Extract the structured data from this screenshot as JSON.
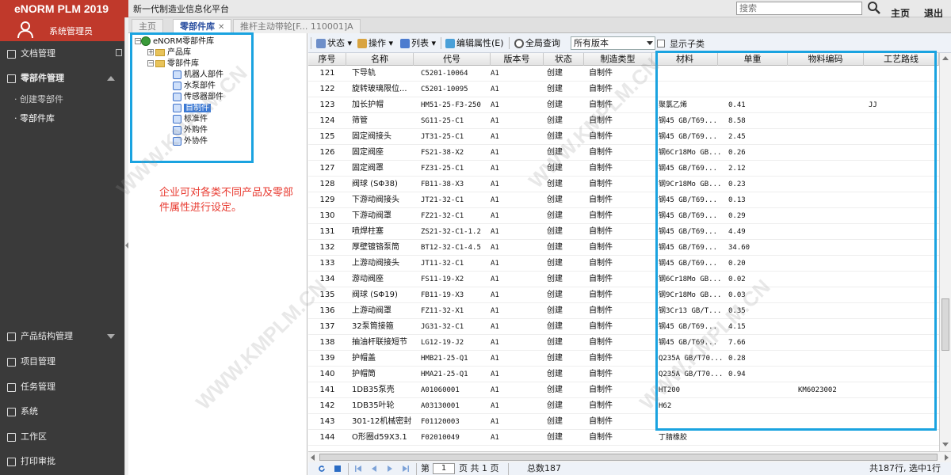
{
  "app": {
    "brand": "eNORM PLM 2019",
    "subtitle": "新一代制造业信息化平台",
    "search_placeholder": "搜索",
    "home_link": "主页",
    "logout_link": "退出"
  },
  "sidebar": {
    "user": "系统管理员",
    "items_top": [
      {
        "label": "文档管理"
      },
      {
        "label": "零部件管理"
      }
    ],
    "sub_items": [
      {
        "label": "· 创建零部件"
      },
      {
        "label": "· 零部件库"
      }
    ],
    "items_bottom": [
      {
        "label": "产品结构管理"
      },
      {
        "label": "项目管理"
      },
      {
        "label": "任务管理"
      },
      {
        "label": "系统"
      },
      {
        "label": "工作区"
      },
      {
        "label": "打印审批"
      }
    ]
  },
  "tabs": [
    {
      "label": "主页"
    },
    {
      "label": "零部件库"
    },
    {
      "label": "推杆主动带轮[F... 110001]A"
    }
  ],
  "tree": {
    "root": "eNORM零部件库",
    "nodes": [
      {
        "label": "产品库"
      },
      {
        "label": "零部件库"
      },
      {
        "label": "机器人部件"
      },
      {
        "label": "水泵部件"
      },
      {
        "label": "传感器部件"
      },
      {
        "label": "自制件"
      },
      {
        "label": "标准件"
      },
      {
        "label": "外购件"
      },
      {
        "label": "外协件"
      }
    ]
  },
  "note": "企业可对各类不同产品及零部件属性进行设定。",
  "toolbar": {
    "status": "状态",
    "operate": "操作",
    "list": "列表",
    "edit_attr": "编辑属性(E)",
    "global_query": "全局查询",
    "version_select": "所有版本",
    "show_children": "显示子类"
  },
  "grid": {
    "headers": [
      "序号",
      "名称",
      "代号",
      "版本号",
      "状态",
      "制造类型",
      "材料",
      "单重",
      "物料编码",
      "工艺路线"
    ],
    "rows": [
      [
        "121",
        "下导轨",
        "C5201-10064",
        "A1",
        "创建",
        "自制件",
        "",
        "",
        "",
        ""
      ],
      [
        "122",
        "旋转玻璃限位...",
        "C5201-10095",
        "A1",
        "创建",
        "自制件",
        "",
        "",
        "",
        ""
      ],
      [
        "123",
        "加长护帽",
        "HM51-25-F3-250",
        "A1",
        "创建",
        "自制件",
        "聚氯乙烯",
        "0.41",
        "",
        "JJ"
      ],
      [
        "124",
        "筛管",
        "SG11-25-C1",
        "A1",
        "创建",
        "自制件",
        "钢45 GB/T69...",
        "8.58",
        "",
        ""
      ],
      [
        "125",
        "固定阀接头",
        "JT31-25-C1",
        "A1",
        "创建",
        "自制件",
        "钢45 GB/T69...",
        "2.45",
        "",
        ""
      ],
      [
        "126",
        "固定阀座",
        "FS21-38-X2",
        "A1",
        "创建",
        "自制件",
        "钢6Cr18Mo GB...",
        "0.26",
        "",
        ""
      ],
      [
        "127",
        "固定阀罩",
        "FZ31-25-C1",
        "A1",
        "创建",
        "自制件",
        "钢45 GB/T69...",
        "2.12",
        "",
        ""
      ],
      [
        "128",
        "阀球 (SΦ38)",
        "FB11-38-X3",
        "A1",
        "创建",
        "自制件",
        "钢9Cr18Mo GB...",
        "0.23",
        "",
        ""
      ],
      [
        "129",
        "下游动阀接头",
        "JT21-32-C1",
        "A1",
        "创建",
        "自制件",
        "钢45 GB/T69...",
        "0.13",
        "",
        ""
      ],
      [
        "130",
        "下游动阀罩",
        "FZ21-32-C1",
        "A1",
        "创建",
        "自制件",
        "钢45 GB/T69...",
        "0.29",
        "",
        ""
      ],
      [
        "131",
        "喷焊柱塞",
        "ZS21-32-C1-1.2",
        "A1",
        "创建",
        "自制件",
        "钢45 GB/T69...",
        "4.49",
        "",
        ""
      ],
      [
        "132",
        "厚壁镀铬泵筒",
        "BT12-32-C1-4.5",
        "A1",
        "创建",
        "自制件",
        "钢45 GB/T69...",
        "34.60",
        "",
        ""
      ],
      [
        "133",
        "上游动阀接头",
        "JT11-32-C1",
        "A1",
        "创建",
        "自制件",
        "钢45 GB/T69...",
        "0.20",
        "",
        ""
      ],
      [
        "134",
        "游动阀座",
        "FS11-19-X2",
        "A1",
        "创建",
        "自制件",
        "钢6Cr18Mo GB...",
        "0.02",
        "",
        ""
      ],
      [
        "135",
        "阀球 (SΦ19)",
        "FB11-19-X3",
        "A1",
        "创建",
        "自制件",
        "钢9Cr18Mo GB...",
        "0.03",
        "",
        ""
      ],
      [
        "136",
        "上游动阀罩",
        "FZ11-32-X1",
        "A1",
        "创建",
        "自制件",
        "钢3Cr13 GB/T...",
        "0.35",
        "",
        ""
      ],
      [
        "137",
        "32泵筒接箍",
        "JG31-32-C1",
        "A1",
        "创建",
        "自制件",
        "钢45 GB/T69...",
        "4.15",
        "",
        ""
      ],
      [
        "138",
        "抽油杆联接短节",
        "LG12-19-J2",
        "A1",
        "创建",
        "自制件",
        "钢45 GB/T69...",
        "7.66",
        "",
        ""
      ],
      [
        "139",
        "护帽盖",
        "HMB21-25-Q1",
        "A1",
        "创建",
        "自制件",
        "Q235A GB/T70...",
        "0.28",
        "",
        ""
      ],
      [
        "140",
        "护帽筒",
        "HMA21-25-Q1",
        "A1",
        "创建",
        "自制件",
        "Q235A GB/T70...",
        "0.94",
        "",
        ""
      ],
      [
        "141",
        "1DB35泵壳",
        "A01060001",
        "A1",
        "创建",
        "自制件",
        "HT200",
        "",
        "KM6023002",
        ""
      ],
      [
        "142",
        "1DB35叶轮",
        "A03130001",
        "A1",
        "创建",
        "自制件",
        "H62",
        "",
        "",
        ""
      ],
      [
        "143",
        "301-12机械密封",
        "F01120003",
        "A1",
        "创建",
        "自制件",
        "",
        "",
        "",
        ""
      ],
      [
        "144",
        "O形圈d59X3.1",
        "F02010049",
        "A1",
        "创建",
        "自制件",
        "丁腈橡胶",
        "",
        "",
        ""
      ]
    ]
  },
  "pager": {
    "page_prefix": "第",
    "page_value": "1",
    "page_suffix": "页  共 1 页",
    "total": "总数187",
    "summary": "共187行, 选中1行"
  },
  "watermark": "WWW.KMPLM.CN",
  "colors": {
    "brand": "#c0392b",
    "highlight": "#1aa3e0",
    "note": "#e83a30"
  }
}
